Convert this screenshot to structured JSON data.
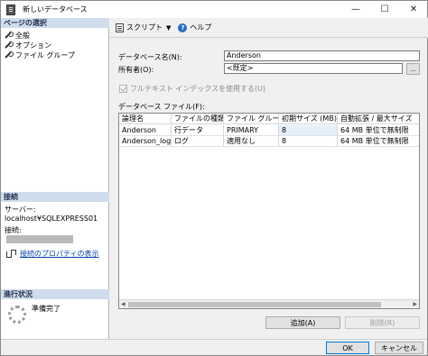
{
  "window": {
    "title": "新しいデータベース",
    "controls": {
      "minimize": "—",
      "maximize": "☐",
      "close": "✕"
    }
  },
  "left_pane": {
    "page_select_header": "ページの選択",
    "pages": [
      {
        "label": "全般",
        "icon": "wrench-icon"
      },
      {
        "label": "オプション",
        "icon": "wrench-icon"
      },
      {
        "label": "ファイル グループ",
        "icon": "wrench-icon"
      }
    ],
    "connection_header": "接続",
    "server_label": "サーバー:",
    "server_value": "localhost¥SQLEXPRESS01",
    "connection_label": "接続:",
    "connection_properties_link": "接続のプロパティの表示",
    "progress_header": "進行状況",
    "progress_status": "準備完了"
  },
  "toolbar": {
    "script_label": "スクリプト",
    "script_caret": "▼",
    "help_label": "ヘルプ",
    "help_icon_glyph": "?"
  },
  "form": {
    "db_name_label": "データベース名(N):",
    "db_name_value": "Anderson",
    "owner_label": "所有者(O):",
    "owner_value": "<既定>",
    "browse_label": "...",
    "fulltext_label": "フルテキスト インデックスを使用する(U)",
    "db_files_label": "データベース ファイル(F):"
  },
  "files_grid": {
    "columns": [
      "論理名",
      "ファイルの種類",
      "ファイル グループ",
      "初期サイズ (MB)",
      "自動拡張 / 最大サイズ"
    ],
    "rows": [
      [
        "Anderson",
        "行データ",
        "PRIMARY",
        "8",
        "64 MB 単位で無制限"
      ],
      [
        "Anderson_log",
        "ログ",
        "適用なし",
        "8",
        "64 MB 単位で無制限"
      ]
    ],
    "scroll_left": "◀",
    "scroll_right": "▶"
  },
  "buttons": {
    "add": "追加(A)",
    "remove": "削除(R)",
    "ok": "OK",
    "cancel": "キャンセル"
  }
}
